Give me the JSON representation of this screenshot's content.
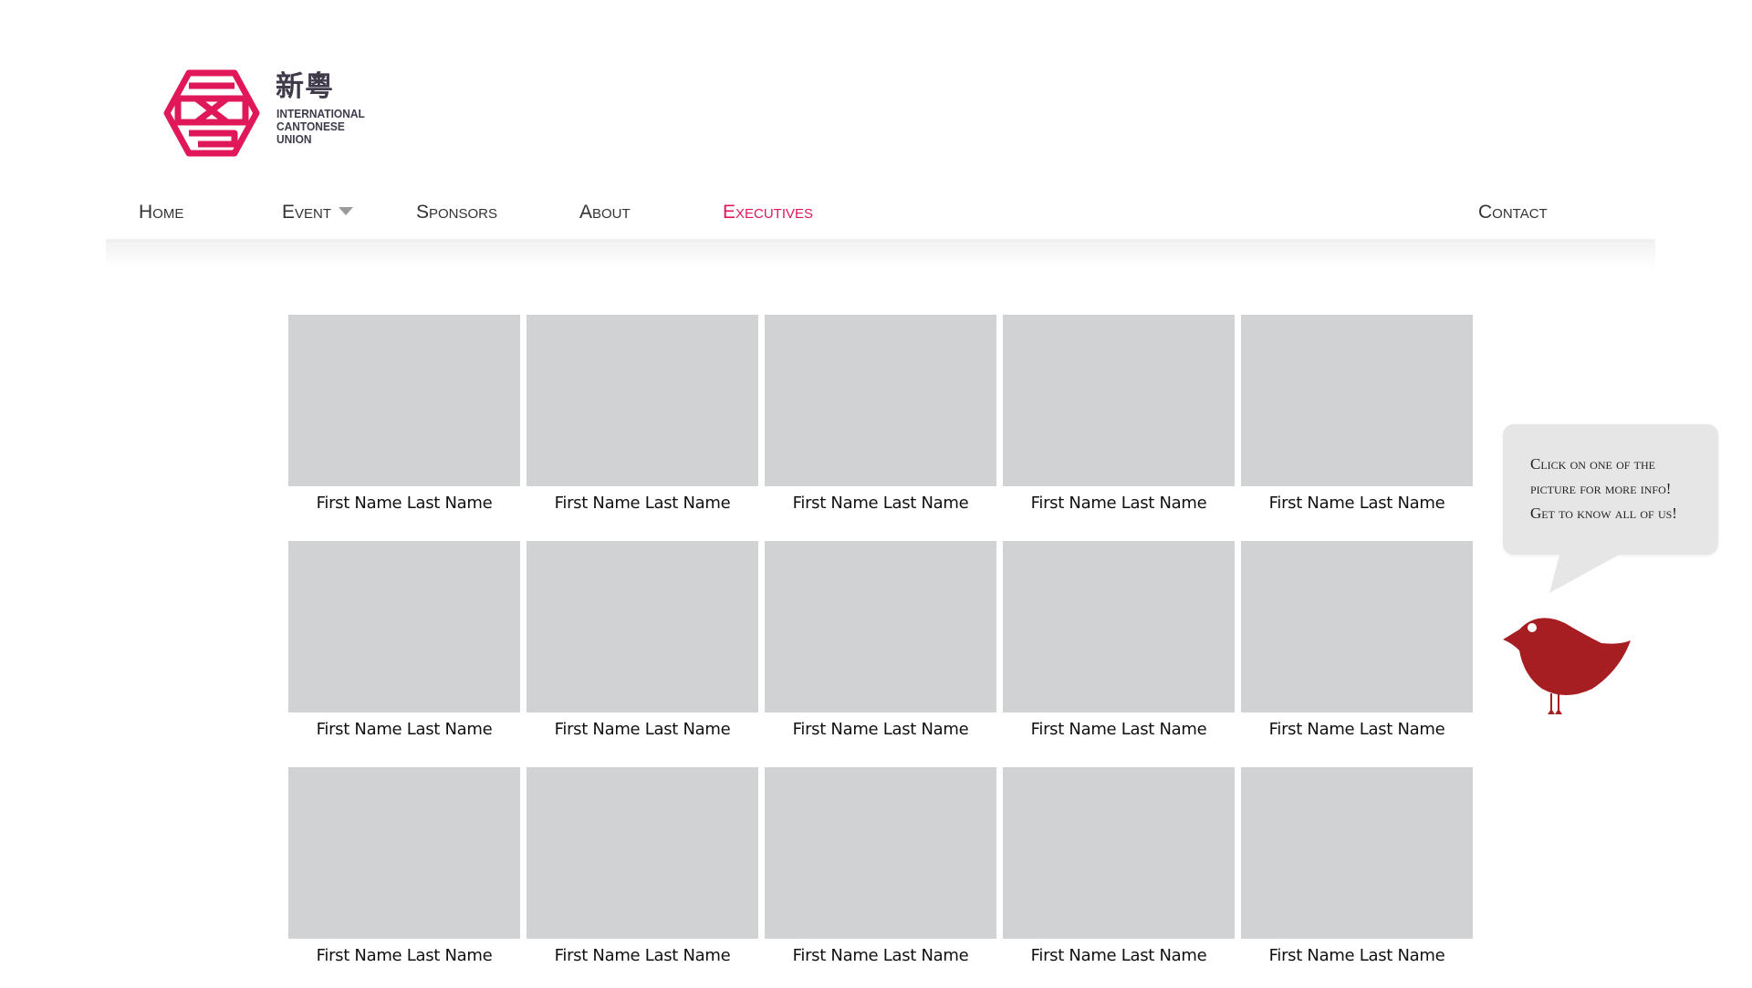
{
  "logo": {
    "cjk": "新粵",
    "lines": [
      "INTERNATIONAL",
      "CANTONESE",
      "UNION"
    ],
    "brand_color": "#e0185a"
  },
  "nav": {
    "items": [
      {
        "label": "Home"
      },
      {
        "label": "Event"
      },
      {
        "label": "Sponsors"
      },
      {
        "label": "About"
      },
      {
        "label": "Executives",
        "active": true
      },
      {
        "label": "Contact"
      }
    ]
  },
  "executives": {
    "rows": [
      [
        "First Name Last Name",
        "First Name Last Name",
        "First Name Last Name",
        "First Name Last Name",
        "First Name Last Name"
      ],
      [
        "First Name Last Name",
        "First Name Last Name",
        "First Name Last Name",
        "First Name Last Name",
        "First Name Last Name"
      ],
      [
        "First Name Last Name",
        "First Name Last Name",
        "First Name Last Name",
        "First Name Last Name",
        "First Name Last Name"
      ]
    ]
  },
  "callout": {
    "lines": [
      "Click on one of the",
      "picture for more info!",
      "Get to know all of us!"
    ],
    "bird_color": "#a61e22"
  }
}
